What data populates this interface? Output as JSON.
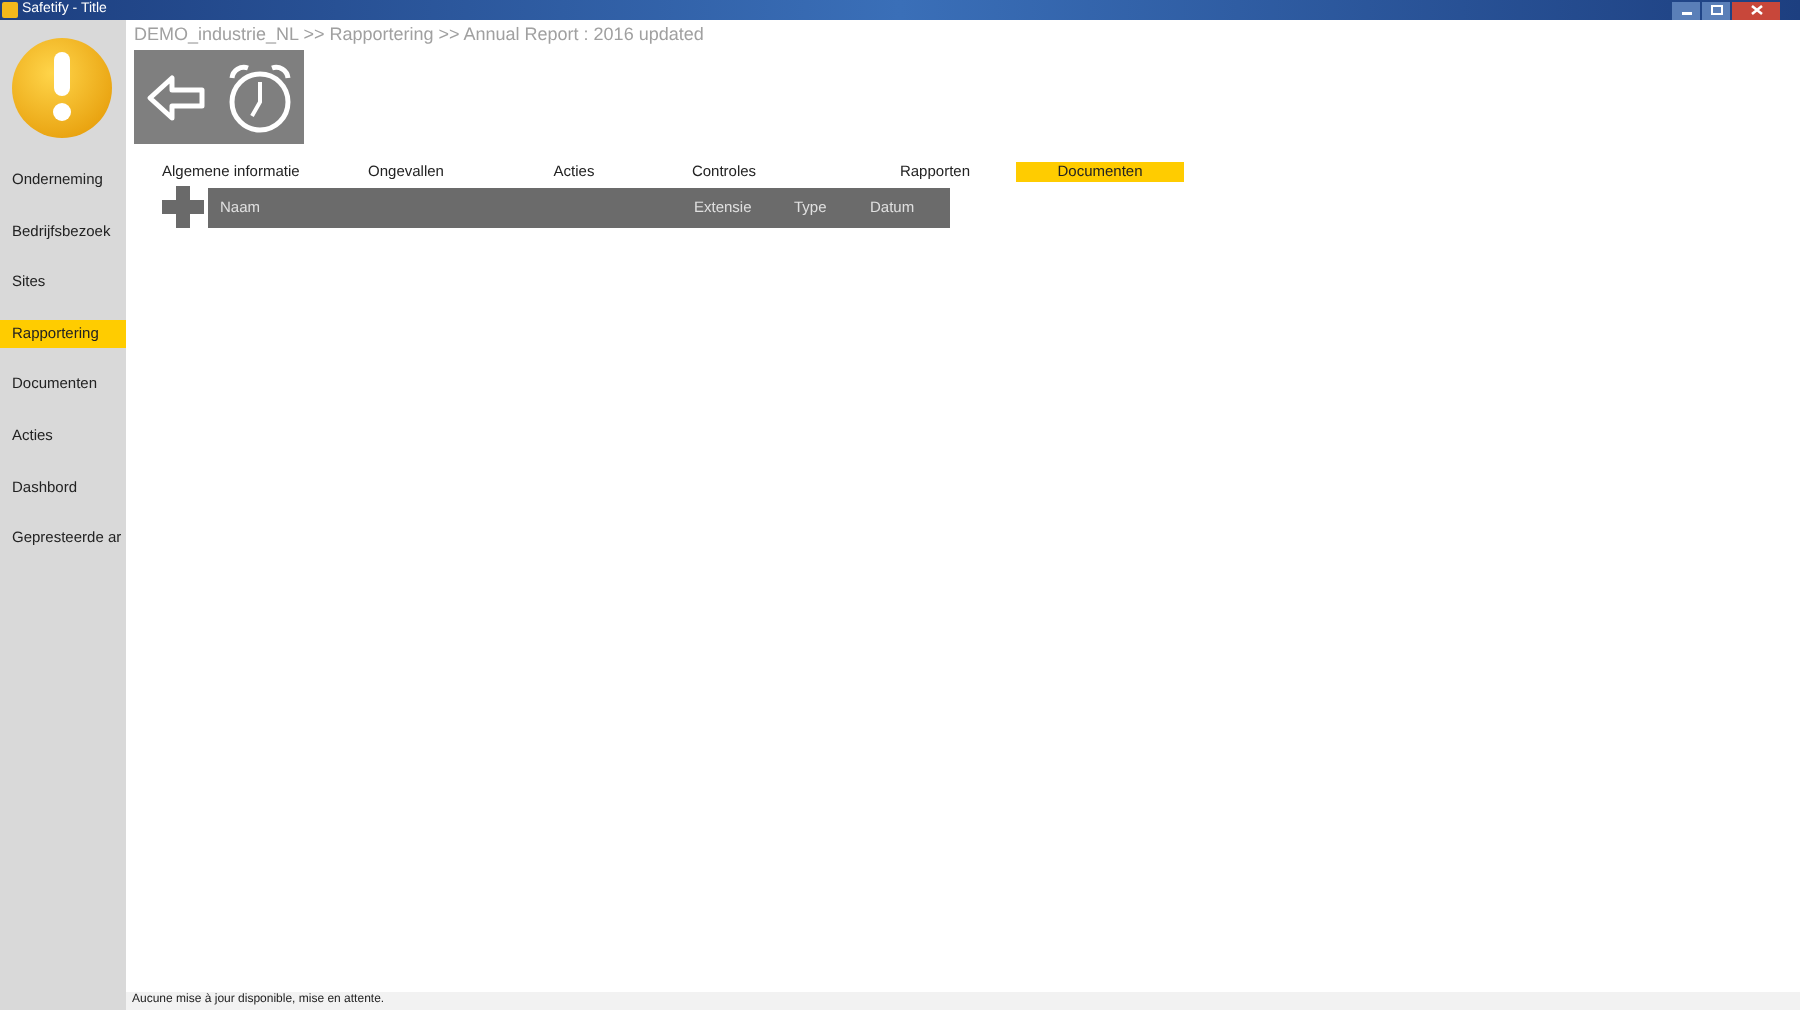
{
  "window": {
    "title": "Safetify - Title"
  },
  "sidebar": {
    "items": [
      {
        "label": "Onderneming",
        "selected": false
      },
      {
        "label": "Bedrijfsbezoek",
        "selected": false
      },
      {
        "label": "Sites",
        "selected": false
      },
      {
        "label": "Rapportering",
        "selected": true
      },
      {
        "label": "Documenten",
        "selected": false
      },
      {
        "label": "Acties",
        "selected": false
      },
      {
        "label": "Dashbord",
        "selected": false
      },
      {
        "label": "Gepresteerde ar",
        "selected": false
      }
    ]
  },
  "breadcrumb": "DEMO_industrie_NL >> Rapportering >> Annual Report : 2016 updated",
  "tabs": [
    {
      "label": "Algemene informatie",
      "selected": false
    },
    {
      "label": "Ongevallen",
      "selected": false
    },
    {
      "label": "Acties",
      "selected": false
    },
    {
      "label": "Controles",
      "selected": false
    },
    {
      "label": "Rapporten",
      "selected": false
    },
    {
      "label": "Documenten",
      "selected": true
    }
  ],
  "table": {
    "columns": [
      "Naam",
      "Extensie",
      "Type",
      "Datum"
    ]
  },
  "status_bar": "Aucune mise à jour disponible, mise en attente."
}
